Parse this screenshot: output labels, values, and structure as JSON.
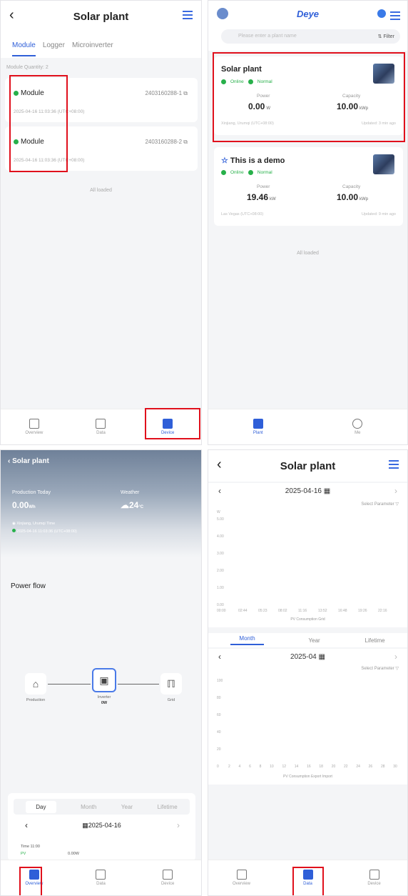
{
  "panel1": {
    "title": "Solar plant",
    "tabs": [
      "Module",
      "Logger",
      "Microinverter"
    ],
    "quantity": "Module Quantity: 2",
    "modules": [
      {
        "name": "Module",
        "sn": "2403160288-1",
        "time": "2025-04-16 11:03:36 (UTC+08:00)"
      },
      {
        "name": "Module",
        "sn": "2403160288-2",
        "time": "2025-04-16 11:03:36 (UTC+08:00)"
      }
    ],
    "footer_note": "All loaded",
    "tabbar": [
      "Overview",
      "Data",
      "Device"
    ]
  },
  "panel2": {
    "logo": "Deye",
    "search_placeholder": "Please enter a plant name",
    "filter": "Filter",
    "plants": [
      {
        "name": "Solar plant",
        "online": "Online",
        "state": "Normal",
        "power_label": "Power",
        "power": "0.00",
        "power_unit": "W",
        "capacity_label": "Capacity",
        "capacity": "10.00",
        "capacity_unit": "kWp",
        "location": "Xinjiang, Urumqi (UTC+08:00)",
        "updated": "Updated: 3 min ago"
      },
      {
        "name": "This is a demo",
        "online": "Online",
        "state": "Normal",
        "power_label": "Power",
        "power": "19.46",
        "power_unit": "kW",
        "capacity_label": "Capacity",
        "capacity": "10.00",
        "capacity_unit": "kWp",
        "location": "Las Vegas (UTC+08:00)",
        "updated": "Updated: 9 min ago"
      }
    ],
    "footer_note": "All loaded",
    "tabbar": [
      "Plant",
      "Me"
    ]
  },
  "panel3": {
    "title": "Solar plant",
    "production_label": "Production Today",
    "production_value": "0.00",
    "production_unit": "Wh",
    "weather_label": "Weather",
    "weather_value": "24",
    "weather_unit": "°C",
    "location": "Xinjiang, Urumqi Time",
    "timestamp": "2025-04-16 11:03:36 (UTC+08:00)",
    "power_flow": "Power flow",
    "nodes": {
      "left": "Production",
      "mid": "Inverter",
      "mid_value": "0W",
      "right": "Grid"
    },
    "day_tabs": [
      "Day",
      "Month",
      "Year",
      "Lifetime"
    ],
    "date": "2025-04-16",
    "time_label": "Time 11:00",
    "pv_label": "PV",
    "pv_value": "0.00W",
    "tabbar": [
      "Overview",
      "Data",
      "Device"
    ]
  },
  "panel4": {
    "title": "Solar plant",
    "date": "2025-04-16",
    "select_param": "Select Parameter",
    "y_unit": "W",
    "y_ticks": [
      "5.00",
      "4.00",
      "3.00",
      "2.00",
      "1.00",
      "0.00"
    ],
    "x_ticks": [
      "00:00",
      "02:44",
      "05:23",
      "08:02",
      "11:16",
      "13:52",
      "16:48",
      "19:26",
      "22:16"
    ],
    "legend1": "PV   Consumption   Grid",
    "period_tabs": [
      "Month",
      "Year",
      "Lifetime"
    ],
    "month": "2025-04",
    "y_ticks2": [
      "100",
      "80",
      "60",
      "40",
      "20",
      "0"
    ],
    "x_ticks2": [
      "2",
      "4",
      "6",
      "8",
      "10",
      "12",
      "14",
      "16",
      "18",
      "20",
      "22",
      "24",
      "26",
      "28",
      "30"
    ],
    "legend2": "PV   Consumption   Export   Import",
    "tabbar": [
      "Overview",
      "Data",
      "Device"
    ]
  }
}
